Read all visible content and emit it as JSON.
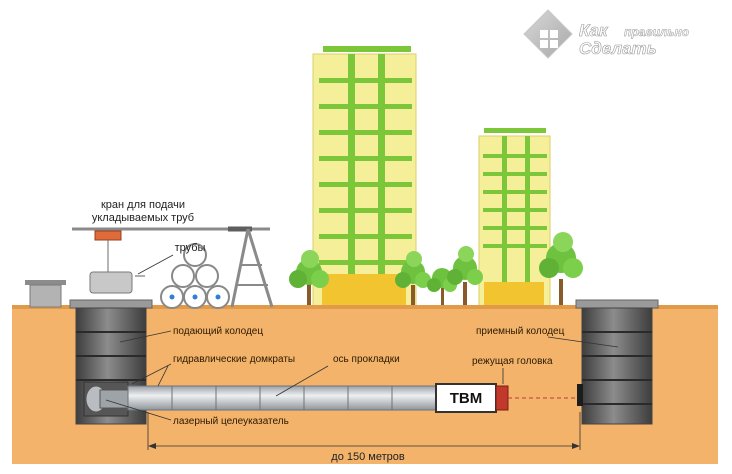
{
  "logo": {
    "line1": "Как",
    "line2": "правильно",
    "line3": "Сделать"
  },
  "labels": {
    "crane": [
      "кран для подачи",
      "укладываемых труб"
    ],
    "pipes": "трубы",
    "feed_shaft": "подающий колодец",
    "receive_shaft": "приемный колодец",
    "jacks": "гидравлические домкраты",
    "axis": "ось прокладки",
    "cutting_head": "режущая головка",
    "laser": "лазерный целеуказатель",
    "tbm": "TBM",
    "distance": "до 150 метров"
  },
  "colors": {
    "ground": "#f3b36b",
    "ground_edge": "#e09a4a",
    "building": "#f5ef9a",
    "building_accent": "#7cc63a",
    "tree": "#6fc23f",
    "shaft": "#6e6e6e",
    "pipe": "#c9ccd1",
    "cutter": "#c0392b",
    "crane_hook": "#e06b3a"
  }
}
